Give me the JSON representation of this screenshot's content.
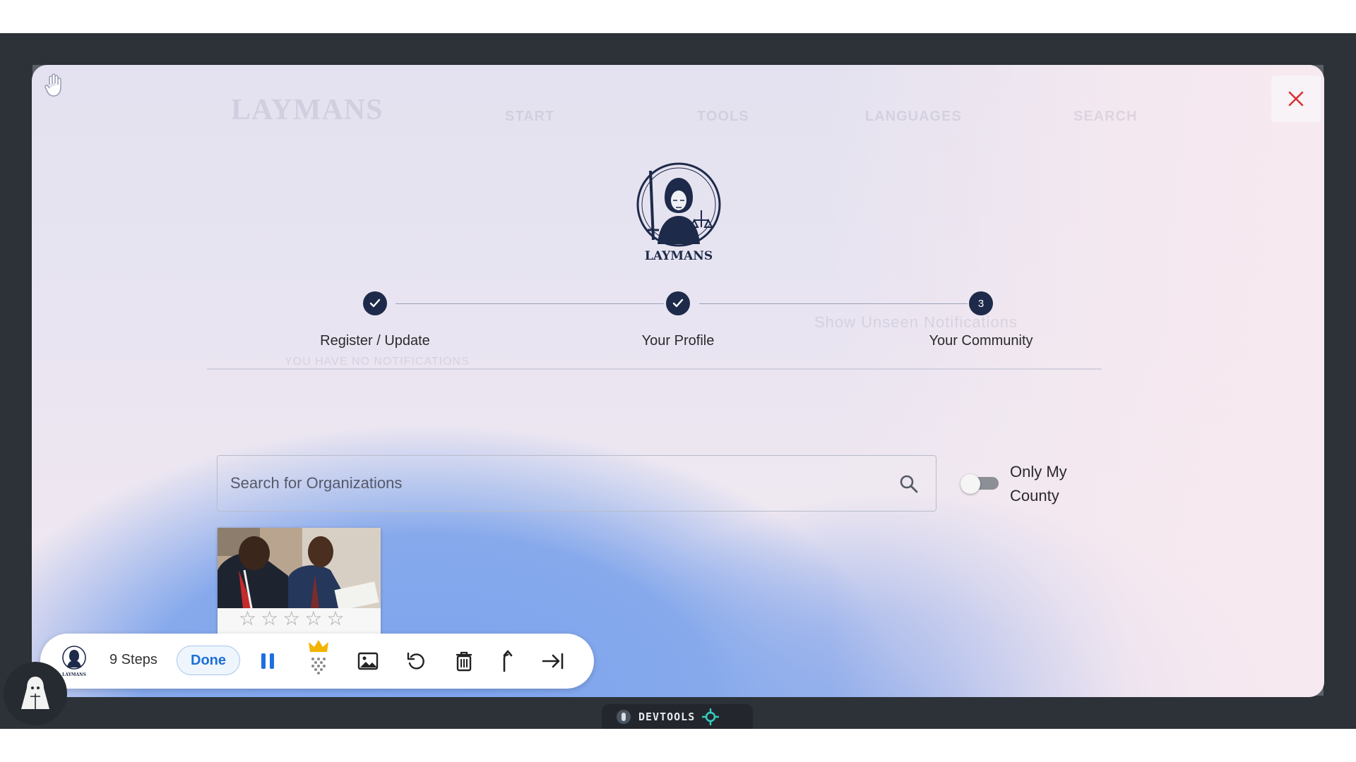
{
  "stepper": {
    "steps": [
      {
        "label": "Register / Update",
        "state": "complete"
      },
      {
        "label": "Your Profile",
        "state": "complete"
      },
      {
        "label": "Your Community",
        "state": "current",
        "number": "3"
      }
    ]
  },
  "logo": {
    "text": "LAYMANS"
  },
  "search": {
    "placeholder": "Search for Organizations",
    "value": ""
  },
  "filter": {
    "toggle_label": "Only My County",
    "enabled": false
  },
  "cards": [
    {
      "rating": 0,
      "max_rating": 5
    }
  ],
  "toolbar": {
    "steps_label": "9 Steps",
    "done_label": "Done",
    "icons": [
      "pause-icon",
      "crown-sparkle-icon",
      "image-icon",
      "undo-icon",
      "trash-icon",
      "arrow-up-icon",
      "skip-to-end-icon"
    ]
  },
  "devtools": {
    "label": "DEVTOOLS"
  },
  "background_app": {
    "brand": "LAYMANS",
    "nav": [
      "START",
      "TOOLS",
      "LANGUAGES",
      "SEARCH"
    ],
    "notice": "Show Unseen Notifications",
    "empty_notice": "YOU HAVE NO NOTIFICATIONS"
  },
  "colors": {
    "primary": "#1e2a4a",
    "close": "#d93030",
    "done_text": "#1d6fd6",
    "pause": "#1e6fe0",
    "crown": "#f2b400"
  }
}
